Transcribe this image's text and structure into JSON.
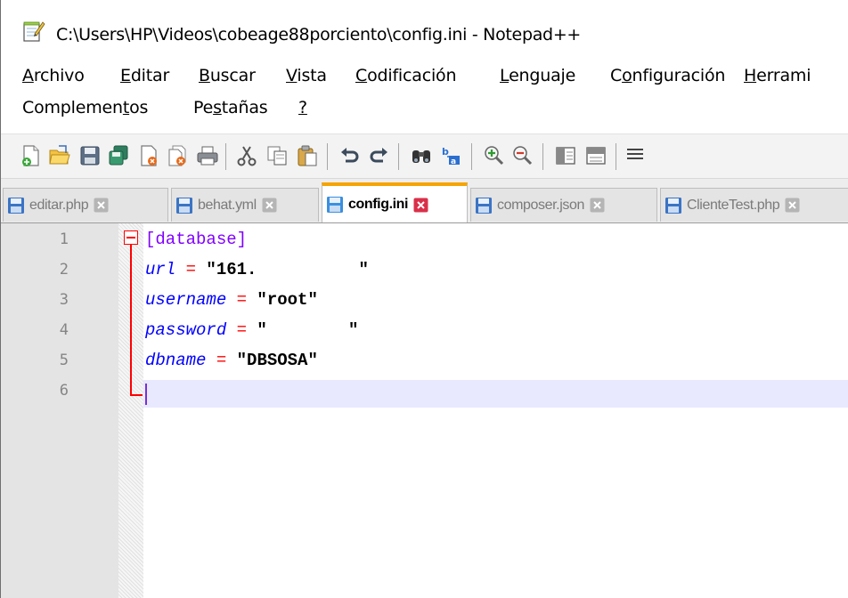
{
  "window": {
    "title": "C:\\Users\\HP\\Videos\\cobeage88porciento\\config.ini - Notepad++",
    "app_icon": "notepad-icon"
  },
  "menu": {
    "row1": [
      {
        "pre": "",
        "u": "A",
        "post": "rchivo",
        "name": "menu-archivo"
      },
      {
        "pre": "",
        "u": "E",
        "post": "ditar",
        "name": "menu-editar"
      },
      {
        "pre": "",
        "u": "B",
        "post": "uscar",
        "name": "menu-buscar"
      },
      {
        "pre": "",
        "u": "V",
        "post": "ista",
        "name": "menu-vista"
      },
      {
        "pre": "",
        "u": "C",
        "post": "odificación",
        "name": "menu-codificacion"
      },
      {
        "pre": "",
        "u": "L",
        "post": "enguaje",
        "name": "menu-lenguaje"
      },
      {
        "pre": "C",
        "u": "o",
        "post": "nfiguración",
        "name": "menu-configuracion"
      },
      {
        "pre": "",
        "u": "H",
        "post": "errami",
        "name": "menu-herramientas"
      }
    ],
    "row2": [
      {
        "pre": "Complemen",
        "u": "t",
        "post": "os",
        "name": "menu-complementos"
      },
      {
        "pre": "Pe",
        "u": "s",
        "post": "tañas",
        "name": "menu-pestanas"
      },
      {
        "pre": "",
        "u": "?",
        "post": "",
        "name": "menu-ayuda"
      }
    ]
  },
  "toolbar": {
    "icons": [
      "new-file-icon",
      "open-file-icon",
      "save-icon",
      "save-all-icon",
      "close-icon",
      "close-all-icon",
      "print-icon",
      "cut-icon",
      "copy-icon",
      "paste-icon",
      "undo-icon",
      "redo-icon",
      "find-icon",
      "replace-icon",
      "zoom-in-icon",
      "zoom-out-icon",
      "sync-vertical-icon",
      "sync-horizontal-icon",
      "word-wrap-icon"
    ]
  },
  "tabs": [
    {
      "label": "editar.php",
      "active": false
    },
    {
      "label": "behat.yml",
      "active": false
    },
    {
      "label": "config.ini",
      "active": true
    },
    {
      "label": "composer.json",
      "active": false
    },
    {
      "label": "ClienteTest.php",
      "active": false
    }
  ],
  "editor": {
    "line_numbers": [
      "1",
      "2",
      "3",
      "4",
      "5",
      "6"
    ],
    "lines": [
      [
        {
          "t": "[database]",
          "c": "sect"
        }
      ],
      [
        {
          "t": "url",
          "c": "key"
        },
        {
          "t": " ",
          "c": "plain"
        },
        {
          "t": "=",
          "c": "op"
        },
        {
          "t": " \"161.          \"",
          "c": "str"
        }
      ],
      [
        {
          "t": "username",
          "c": "key"
        },
        {
          "t": " ",
          "c": "plain"
        },
        {
          "t": "=",
          "c": "op"
        },
        {
          "t": " \"root\"",
          "c": "str"
        }
      ],
      [
        {
          "t": "password",
          "c": "key"
        },
        {
          "t": " ",
          "c": "plain"
        },
        {
          "t": "=",
          "c": "op"
        },
        {
          "t": " \"        \"",
          "c": "str"
        }
      ],
      [
        {
          "t": "dbname",
          "c": "key"
        },
        {
          "t": " ",
          "c": "plain"
        },
        {
          "t": "=",
          "c": "op"
        },
        {
          "t": " \"DBSOSA\"",
          "c": "str"
        }
      ],
      []
    ],
    "current_line": "6"
  }
}
